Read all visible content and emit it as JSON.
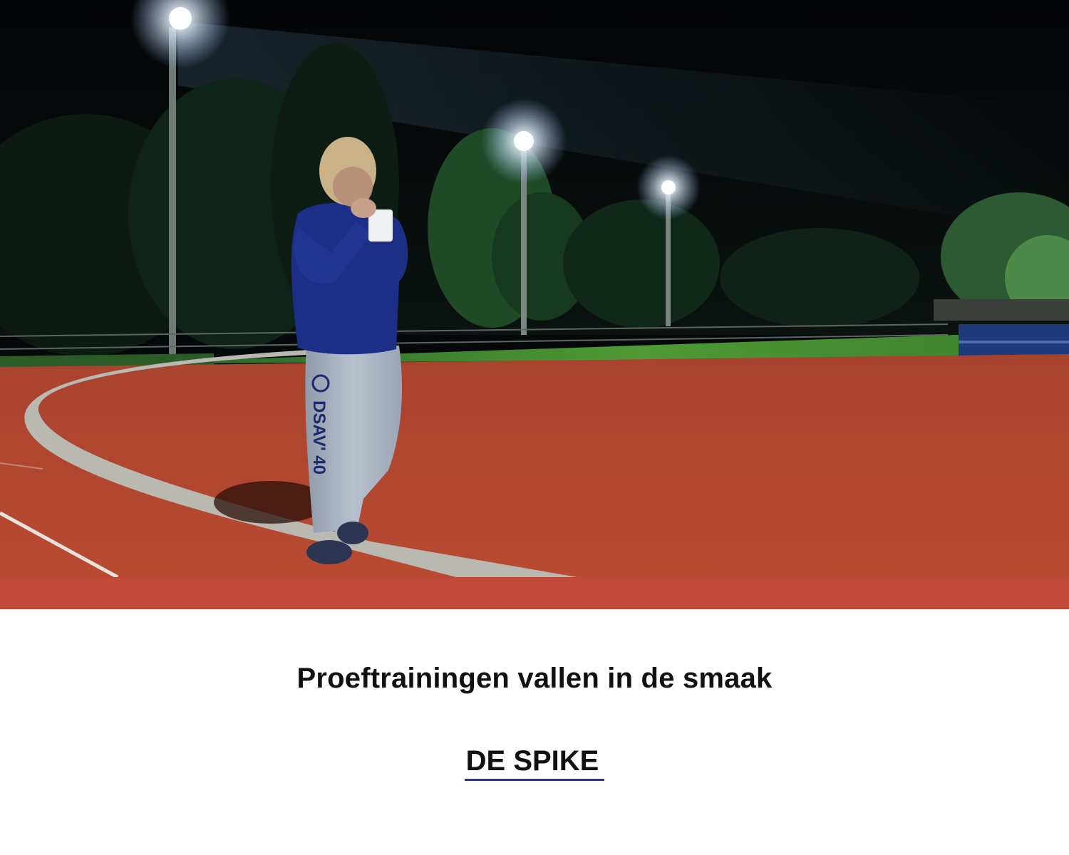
{
  "hero": {
    "image_subject": "Athlete in blue hoodie and grey DSAV'40 sweatpants walking on a floodlit red running track at night",
    "pants_text": "DSAV' 40"
  },
  "article": {
    "headline": "Proeftrainingen vallen in de smaak",
    "source_link": "DE SPIKE"
  },
  "colors": {
    "accent_band": "#c0493a",
    "track": "#b5452e",
    "hoodie": "#1d2e86",
    "link_underline": "#1f3a8a",
    "text": "#111111"
  }
}
